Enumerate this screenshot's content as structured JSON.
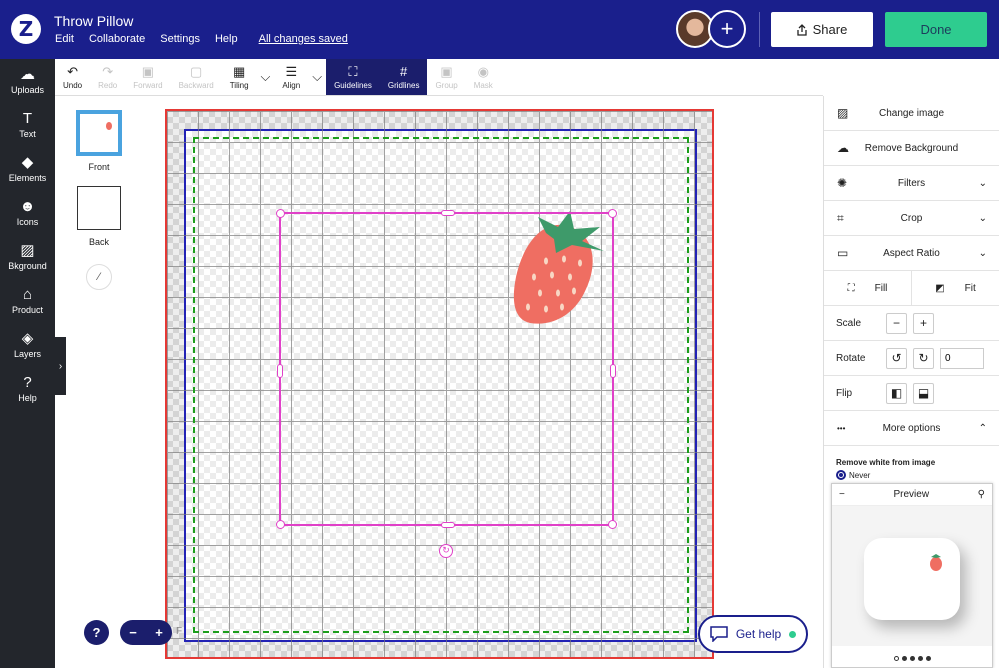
{
  "app": {
    "logo_glyph": "Z",
    "title": "Throw Pillow",
    "menu": [
      "Edit",
      "Collaborate",
      "Settings",
      "Help"
    ],
    "save_status": "All changes saved",
    "add_collaborator_glyph": "+",
    "share_label": "Share",
    "done_label": "Done",
    "colors": {
      "header": "#1a1f8c",
      "done": "#2ecc8f",
      "sidebar": "#23262c"
    }
  },
  "sidebar": {
    "items": [
      {
        "label": "Uploads",
        "icon": "cloud-upload-icon",
        "glyph": "☁"
      },
      {
        "label": "Text",
        "icon": "text-icon",
        "glyph": "T"
      },
      {
        "label": "Elements",
        "icon": "elements-icon",
        "glyph": "◆"
      },
      {
        "label": "Icons",
        "icon": "smiley-icon",
        "glyph": "☻"
      },
      {
        "label": "Bkground",
        "icon": "background-icon",
        "glyph": "▨"
      },
      {
        "label": "Product",
        "icon": "product-icon",
        "glyph": "⌂"
      },
      {
        "label": "Layers",
        "icon": "layers-icon",
        "glyph": "◈"
      },
      {
        "label": "Help",
        "icon": "help-icon",
        "glyph": "?"
      }
    ],
    "collapse_glyph": "›"
  },
  "toolbar": {
    "undo": {
      "label": "Undo",
      "glyph": "↶"
    },
    "redo": {
      "label": "Redo",
      "glyph": "↷"
    },
    "forward": {
      "label": "Forward",
      "glyph": "▣"
    },
    "backward": {
      "label": "Backward",
      "glyph": "▢"
    },
    "tiling": {
      "label": "Tiling",
      "glyph": "▦"
    },
    "align": {
      "label": "Align",
      "glyph": "☰"
    },
    "guidelines": {
      "label": "Guidelines",
      "glyph": "⛶"
    },
    "gridlines": {
      "label": "Gridlines",
      "glyph": "#"
    },
    "group": {
      "label": "Group",
      "glyph": "▣"
    },
    "mask": {
      "label": "Mask",
      "glyph": "◉"
    },
    "chevron_glyph": "⌵"
  },
  "pages": {
    "front_label": "Front",
    "back_label": "Back",
    "edit_glyph": "⁄"
  },
  "canvas": {
    "rotate_glyph": "↻"
  },
  "zoom": {
    "help_glyph": "?",
    "minus": "−",
    "plus": "+",
    "fit_label": "F"
  },
  "get_help": {
    "label": "Get help",
    "glyph": "▭"
  },
  "right_panel": {
    "change_image": "Change image",
    "remove_background": "Remove Background",
    "filters": "Filters",
    "crop": "Crop",
    "aspect_ratio": "Aspect Ratio",
    "fill": "Fill",
    "fit": "Fit",
    "scale": "Scale",
    "rotate": "Rotate",
    "rotate_value": "0",
    "flip": "Flip",
    "more_options": "More options",
    "remove_white_title": "Remove white from image",
    "never_option": "Never",
    "chevron_down": "⌄",
    "chevron_up": "⌃",
    "minus": "−",
    "plus": "+",
    "rotate_left": "↺",
    "rotate_right": "↻",
    "flip_h": "◧",
    "flip_v": "⬓",
    "dots": "•••",
    "icons": {
      "change": "▨",
      "remove_bg": "☁",
      "filters": "✺",
      "crop": "⌗",
      "aspect": "▭",
      "fill": "⛶",
      "fit": "◩"
    }
  },
  "preview": {
    "title": "Preview",
    "collapse": "−",
    "zoom_glyph": "⚲"
  }
}
